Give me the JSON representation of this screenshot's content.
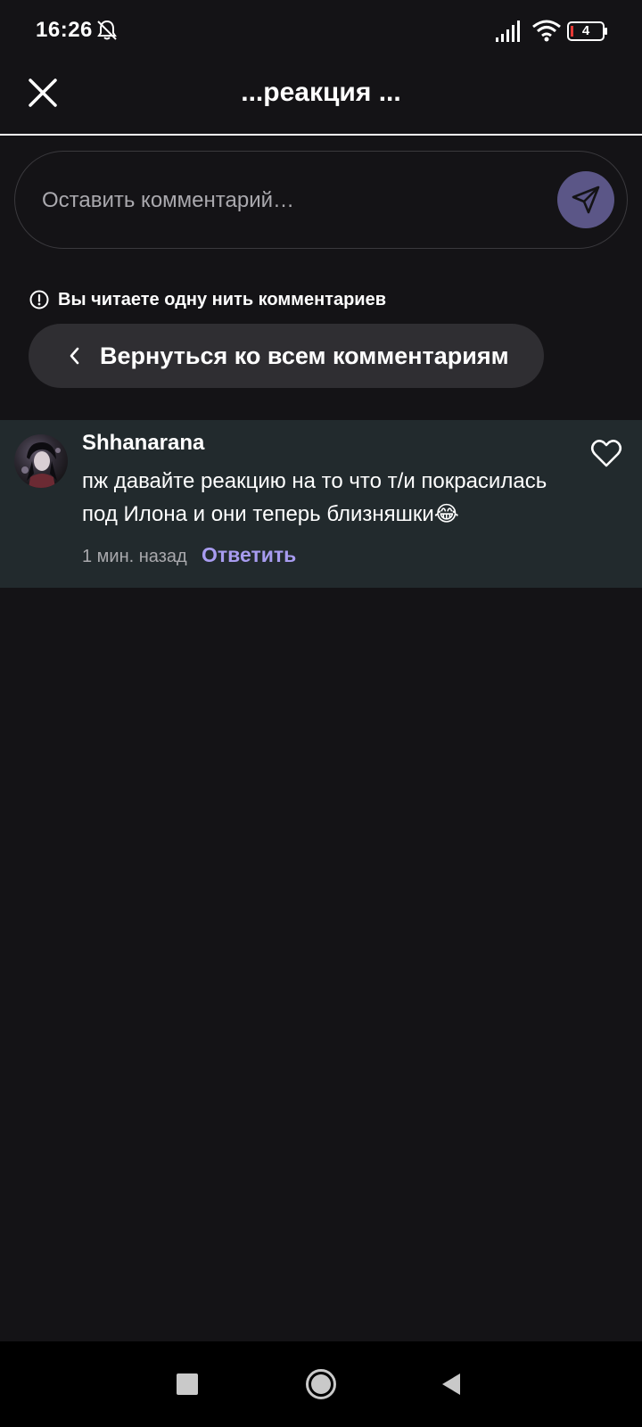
{
  "status_bar": {
    "time": "16:26",
    "battery": "4",
    "icons": [
      "bell-off-icon",
      "signal-icon",
      "wifi-icon",
      "battery-icon"
    ]
  },
  "header": {
    "title": "...реакция ...",
    "close_icon": "close-icon"
  },
  "comment_input": {
    "placeholder": "Оставить комментарий…",
    "value": "",
    "send_icon": "send-icon"
  },
  "thread": {
    "notice": "Вы читаете одну нить комментариев",
    "back_label": "Вернуться ко всем комментариям"
  },
  "comment": {
    "author": "Shhanarana",
    "text": "пж давайте реакцию на то что т/и покрасилась под Илона и они теперь близняшки😂",
    "time": "1 мин. назад",
    "reply_label": "Ответить"
  },
  "colors": {
    "background": "#141316",
    "accent": "#a89cf0",
    "send_button": "#5b5687",
    "comment_highlight": "#222a2d",
    "pill": "#2f2e32"
  }
}
